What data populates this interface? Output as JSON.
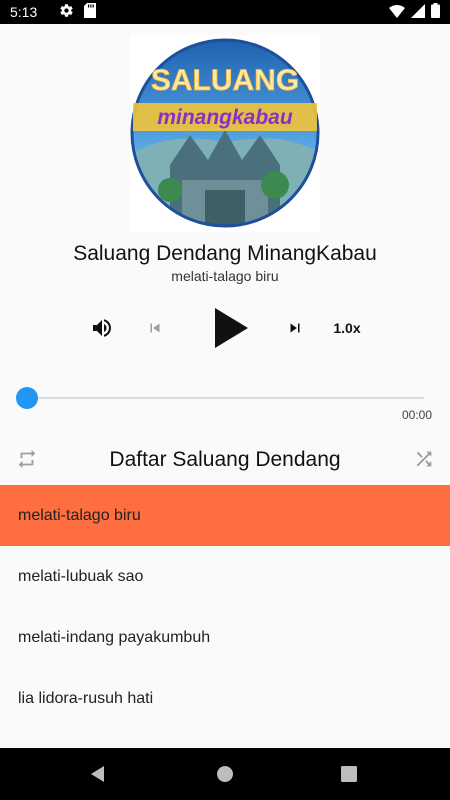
{
  "status_bar": {
    "time": "5:13"
  },
  "album_art": {
    "line1": "SALUANG",
    "line2": "minangkabau"
  },
  "now_playing": {
    "title": "Saluang Dendang MinangKabau",
    "artist": "melati-talago biru"
  },
  "controls": {
    "speed": "1.0x"
  },
  "progress": {
    "value": 0,
    "duration": "00:00"
  },
  "playlist": {
    "title": "Daftar Saluang Dendang",
    "tracks": [
      {
        "label": "melati-talago biru"
      },
      {
        "label": "melati-lubuak sao"
      },
      {
        "label": "melati-indang payakumbuh"
      },
      {
        "label": "lia lidora-rusuh hati"
      }
    ]
  },
  "colors": {
    "accent": "#ff6e40",
    "seek_thumb": "#2196f3"
  }
}
